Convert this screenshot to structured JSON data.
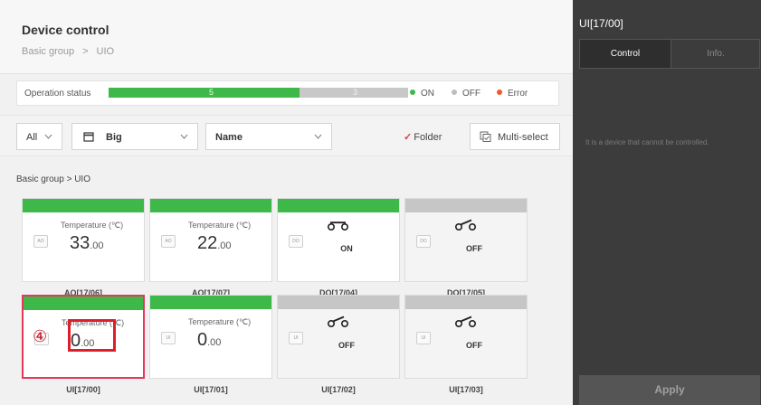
{
  "header": {
    "title": "Device control",
    "breadcrumb": [
      "Basic group",
      "UIO"
    ],
    "separator": ">"
  },
  "operation_status": {
    "label": "Operation status",
    "on_count": "5",
    "off_count": "3",
    "on_fraction": 0.636,
    "legend": [
      {
        "label": "ON",
        "color": "#3fb84a"
      },
      {
        "label": "OFF",
        "color": "#bdbdbd"
      },
      {
        "label": "Error",
        "color": "#f05a28"
      }
    ]
  },
  "toolbar": {
    "filter": "All",
    "view": "Big",
    "sort": "Name",
    "folder_label": "Folder",
    "folder_checked": true,
    "multiselect_label": "Multi-select"
  },
  "group_path": "Basic group > UIO",
  "devices": [
    {
      "name": "AO[17/06]",
      "type": "temp",
      "chip": "AO",
      "label": "Temperature (℃)",
      "value": "33",
      "decimals": ".00",
      "status": "on"
    },
    {
      "name": "AO[17/07]",
      "type": "temp",
      "chip": "AO",
      "label": "Temperature (℃)",
      "value": "22",
      "decimals": ".00",
      "status": "on"
    },
    {
      "name": "DO[17/04]",
      "type": "digital",
      "chip": "DO",
      "state": "ON",
      "status": "on"
    },
    {
      "name": "DO[17/05]",
      "type": "digital",
      "chip": "DO",
      "state": "OFF",
      "status": "off"
    },
    {
      "name": "UI[17/00]",
      "type": "temp",
      "chip": "UI",
      "label": "Temperature (℃)",
      "value": "0",
      "decimals": ".00",
      "status": "on",
      "selected": true
    },
    {
      "name": "UI[17/01]",
      "type": "temp",
      "chip": "UI",
      "label": "Temperature (℃)",
      "value": "0",
      "decimals": ".00",
      "status": "on"
    },
    {
      "name": "UI[17/02]",
      "type": "digital",
      "chip": "UI",
      "state": "OFF",
      "status": "off"
    },
    {
      "name": "UI[17/03]",
      "type": "digital",
      "chip": "UI",
      "state": "OFF",
      "status": "off"
    }
  ],
  "callout": "④",
  "panel": {
    "title": "UI[17/00]",
    "tabs": [
      "Control",
      "Info."
    ],
    "message": "It is a device that cannot be controlled.",
    "apply_label": "Apply"
  }
}
